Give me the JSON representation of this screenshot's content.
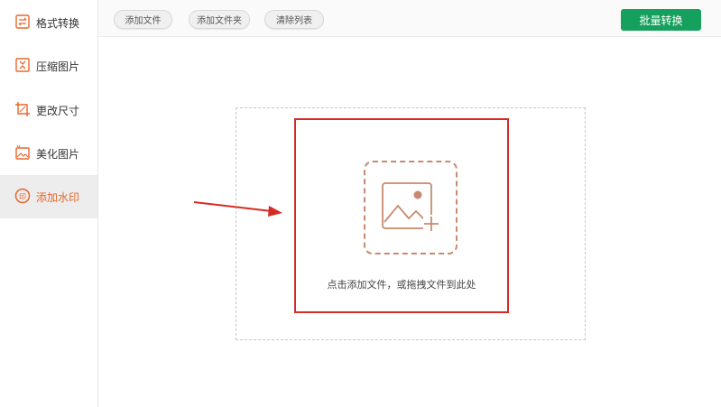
{
  "sidebar": {
    "items": [
      {
        "label": "格式转换",
        "icon": "format-convert-icon"
      },
      {
        "label": "压缩图片",
        "icon": "compress-image-icon"
      },
      {
        "label": "更改尺寸",
        "icon": "resize-icon"
      },
      {
        "label": "美化图片",
        "icon": "beautify-image-icon"
      },
      {
        "label": "添加水印",
        "icon": "watermark-icon",
        "active": true
      }
    ]
  },
  "toolbar": {
    "add_file_label": "添加文件",
    "add_folder_label": "添加文件夹",
    "clear_list_label": "清除列表",
    "batch_convert_label": "批量转换"
  },
  "dropzone": {
    "hint": "点击添加文件，或拖拽文件到此处"
  },
  "colors": {
    "accent": "#e8662f",
    "batch_button": "#16a05d",
    "highlight_border": "#d62b25",
    "arrow": "#d62b25",
    "icon_stroke": "#c88a6e"
  }
}
